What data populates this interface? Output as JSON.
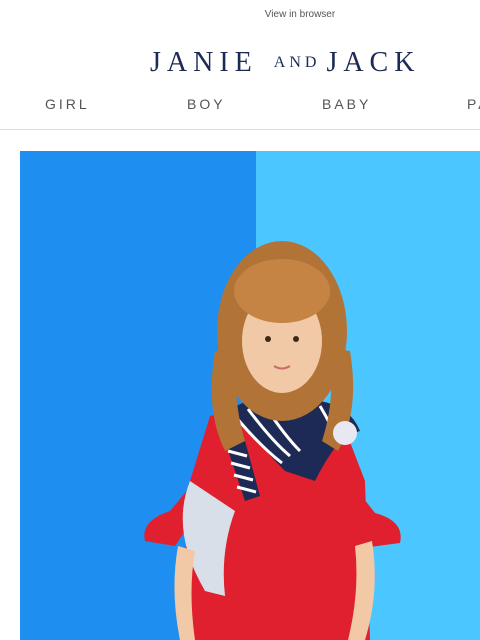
{
  "header": {
    "view_in_browser": "View in browser",
    "logo_primary_left": "JANIE",
    "logo_middle": "AND",
    "logo_primary_right": "JACK"
  },
  "nav": {
    "items": [
      {
        "label": "GIRL"
      },
      {
        "label": "BOY"
      },
      {
        "label": "BABY"
      },
      {
        "label": "PA"
      }
    ]
  },
  "colors": {
    "brand_navy": "#1c2a55",
    "hero_left_blue": "#1e8ef0",
    "hero_right_blue": "#4cc6ff",
    "dress_red": "#e0202e"
  },
  "hero": {
    "image_alt": "girl in red dress with striped sweater"
  }
}
